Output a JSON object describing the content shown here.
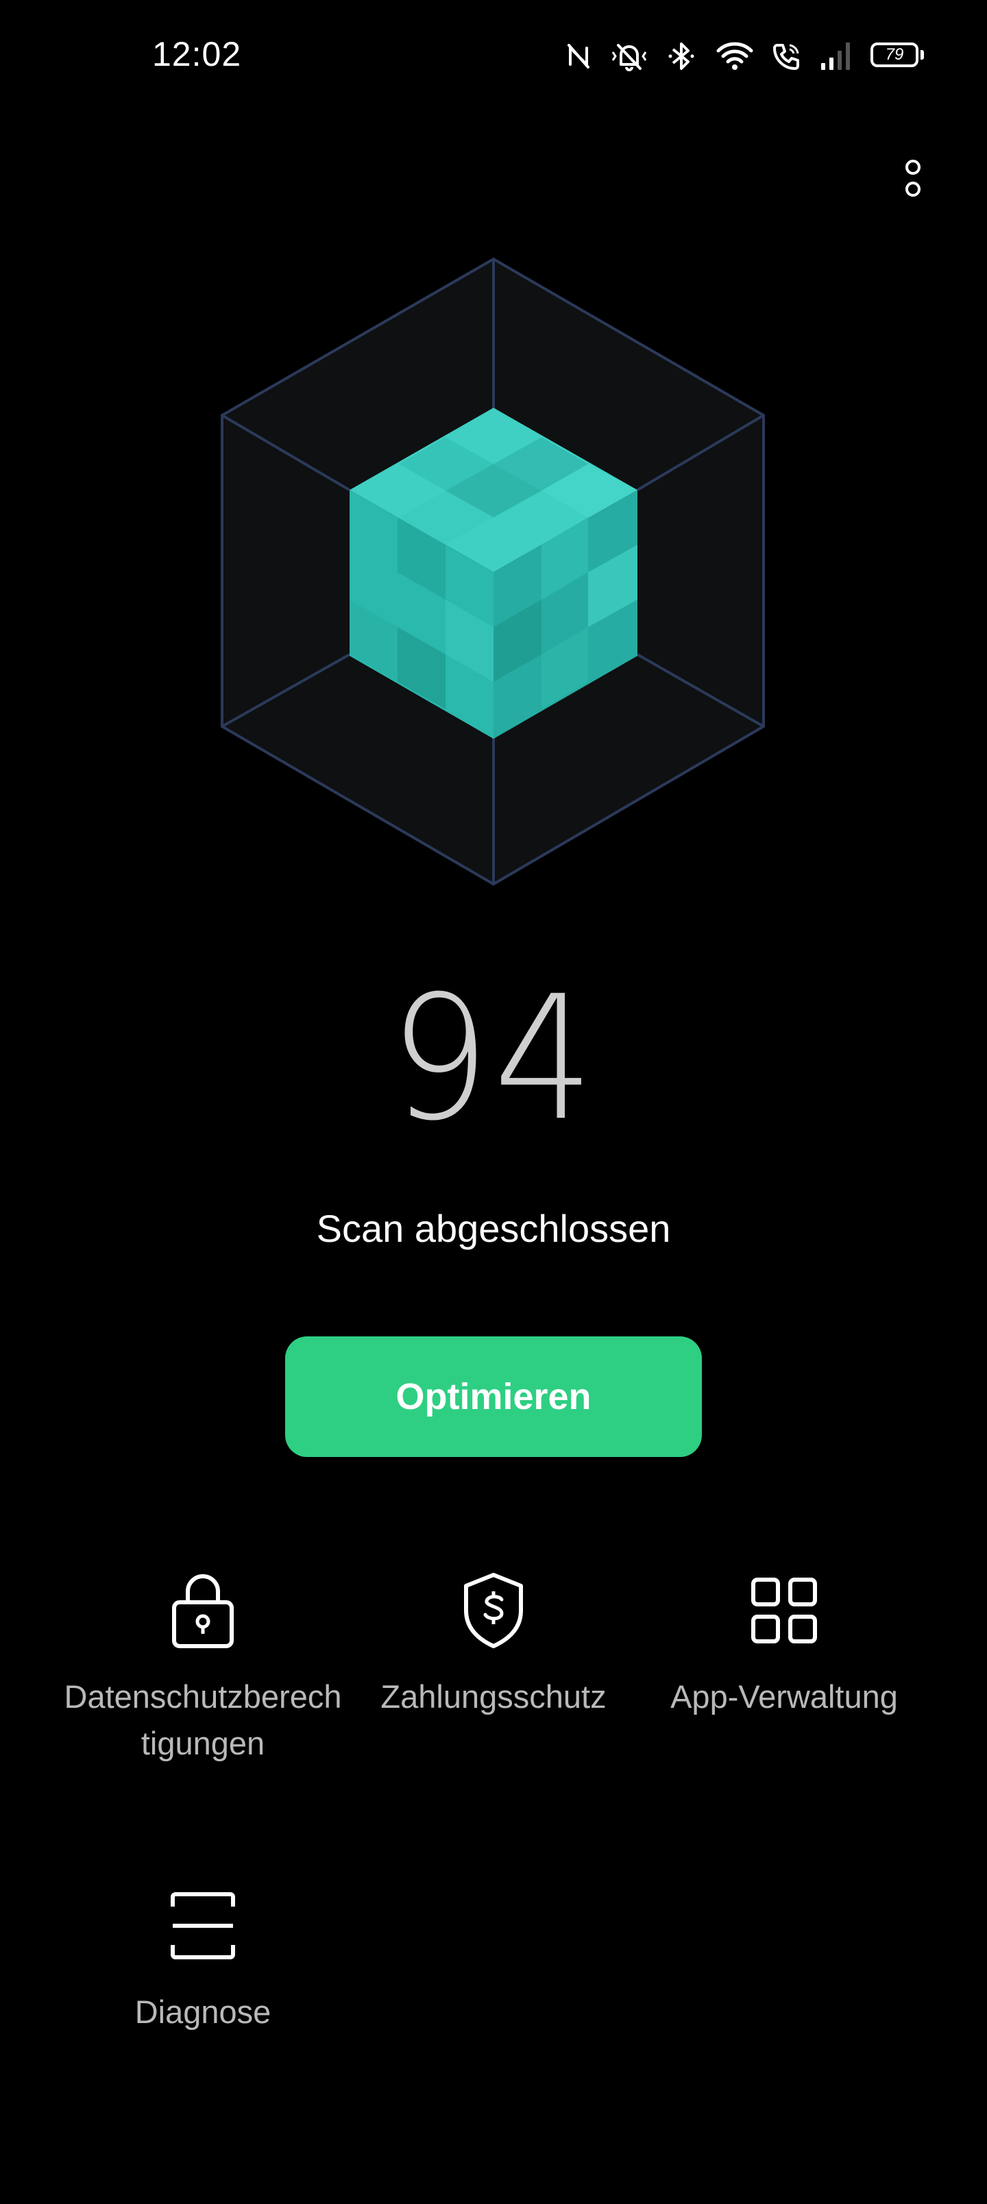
{
  "status_bar": {
    "time": "12:02",
    "battery_level": "79",
    "icons": [
      "nfc-icon",
      "vibrate-silent-icon",
      "bluetooth-icon",
      "wifi-icon",
      "wifi-call-icon",
      "signal-icon",
      "battery-icon"
    ]
  },
  "menu": {
    "icon": "more-vertical-icon"
  },
  "hero": {
    "icon": "security-cube-icon",
    "accent_color": "#3cc9be"
  },
  "score": {
    "value": "94",
    "status": "Scan abgeschlossen"
  },
  "optimize_button": {
    "label": "Optimieren",
    "color": "#2ecf83"
  },
  "features": [
    {
      "label": "Datenschutzberech tigungen",
      "line1": "Datenschutzberech",
      "line2": "tigungen",
      "icon": "lock-icon"
    },
    {
      "label": "Zahlungsschutz",
      "icon": "payment-shield-icon"
    },
    {
      "label": "App-Verwaltung",
      "icon": "app-grid-icon"
    },
    {
      "label": "Diagnose",
      "icon": "scan-icon"
    }
  ]
}
